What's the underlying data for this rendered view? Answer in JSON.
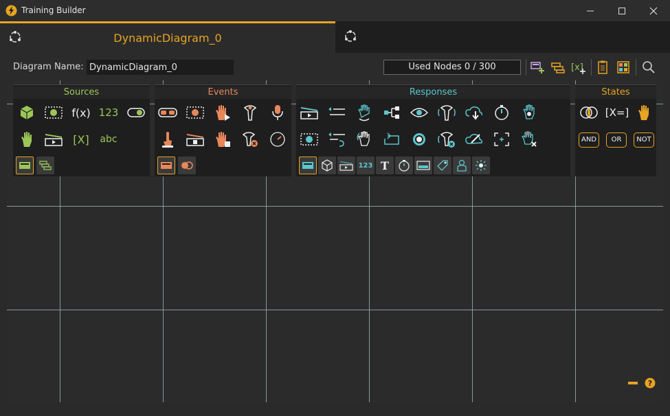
{
  "window": {
    "title": "Training Builder"
  },
  "tabs": [
    {
      "label": "DynamicDiagram_0",
      "active": true
    },
    {
      "label": "",
      "active": false
    }
  ],
  "toolbar": {
    "diagram_name_label": "Diagram Name:",
    "diagram_name_value": "DynamicDiagram_0",
    "used_nodes": "Used Nodes 0 / 300"
  },
  "palettes": {
    "sources": {
      "title": "Sources",
      "fx_label": "f(x)",
      "num_label": "123",
      "var_label": "[X]",
      "str_label": "abc"
    },
    "events": {
      "title": "Events"
    },
    "responses": {
      "title": "Responses",
      "num_label": "123",
      "text_label": "T"
    },
    "states": {
      "title": "States",
      "assign_label": "[X=]",
      "and_label": "AND",
      "or_label": "OR",
      "not_label": "NOT"
    }
  },
  "colors": {
    "accent": "#e8a422",
    "sources": "#9cc657",
    "events": "#e8875a",
    "responses": "#5bc6cc",
    "states": "#e8a422"
  }
}
